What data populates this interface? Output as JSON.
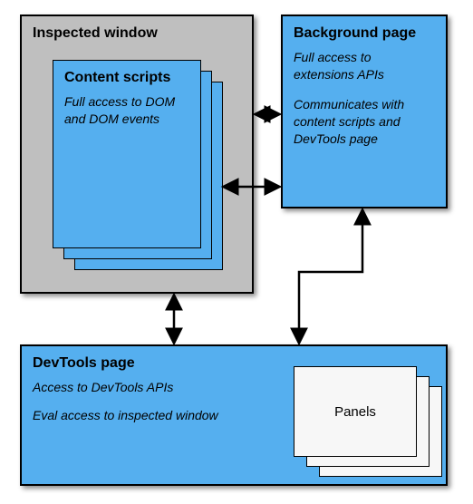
{
  "inspected": {
    "title": "Inspected window",
    "content_scripts": {
      "title": "Content scripts",
      "desc": "Full access to DOM and DOM events"
    }
  },
  "background": {
    "title": "Background page",
    "desc1": "Full access to extensions APIs",
    "desc2": "Communicates with content scripts and DevTools page"
  },
  "devtools": {
    "title": "DevTools page",
    "desc1": "Access to DevTools APIs",
    "desc2": "Eval access to inspected window",
    "panels_label": "Panels"
  },
  "colors": {
    "blue": "#55afef",
    "gray": "#bfbfbf"
  }
}
